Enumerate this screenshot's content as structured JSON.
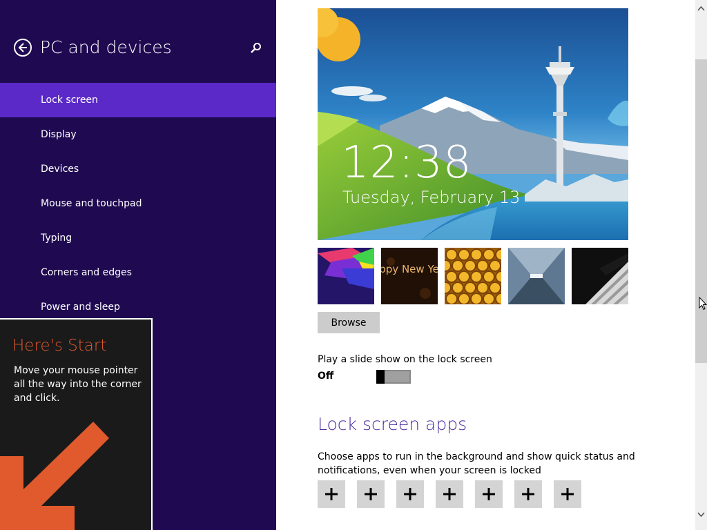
{
  "nav": {
    "title": "PC and devices",
    "back_icon": "back-arrow-icon",
    "search_icon": "search-icon",
    "items": [
      {
        "label": "Lock screen",
        "selected": true
      },
      {
        "label": "Display",
        "selected": false
      },
      {
        "label": "Devices",
        "selected": false
      },
      {
        "label": "Mouse and touchpad",
        "selected": false
      },
      {
        "label": "Typing",
        "selected": false
      },
      {
        "label": "Corners and edges",
        "selected": false
      },
      {
        "label": "Power and sleep",
        "selected": false
      }
    ],
    "colors": {
      "background": "#1f0a52",
      "selected": "#5b29c7"
    }
  },
  "tip": {
    "title": "Here's Start",
    "body": "Move your mouse pointer all the way into the corner and click.",
    "accent": "#e05a2d"
  },
  "lock_screen": {
    "preview": {
      "time": "12:38",
      "date": "Tuesday, February 13"
    },
    "thumbnails": [
      {
        "name": "abstract-colors"
      },
      {
        "name": "happy-new-year",
        "text": "Happy New Year!"
      },
      {
        "name": "honeycomb"
      },
      {
        "name": "tunnel"
      },
      {
        "name": "piano-keys"
      }
    ],
    "browse_label": "Browse",
    "slideshow": {
      "label": "Play a slide show on the lock screen",
      "state": "Off"
    },
    "apps": {
      "title": "Lock screen apps",
      "description": "Choose apps to run in the background and show quick status and notifications, even when your screen is locked",
      "slot_count": 7,
      "slots": [
        {
          "icon": "plus-icon"
        },
        {
          "icon": "plus-icon"
        },
        {
          "icon": "plus-icon"
        },
        {
          "icon": "plus-icon"
        },
        {
          "icon": "plus-icon"
        },
        {
          "icon": "plus-icon"
        },
        {
          "icon": "plus-icon"
        }
      ]
    }
  }
}
